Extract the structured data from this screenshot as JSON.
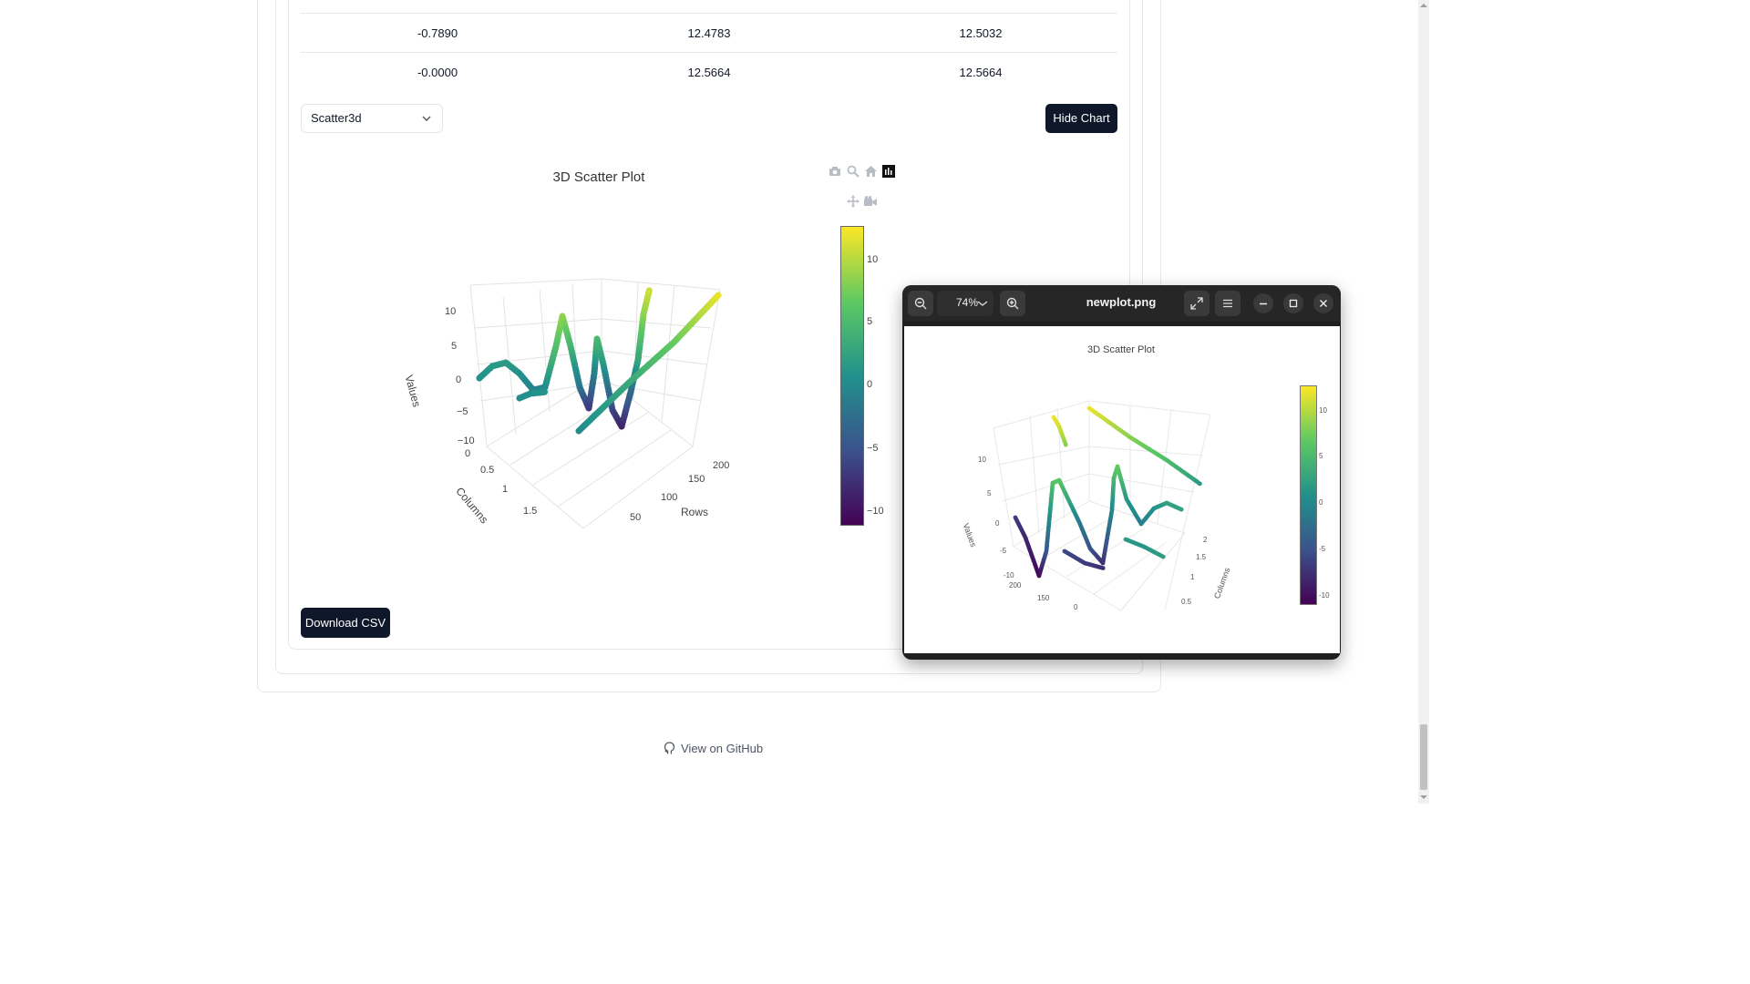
{
  "table": {
    "rows": [
      [
        "-0.7890",
        "12.4783",
        "12.5032"
      ],
      [
        "-0.0000",
        "12.5664",
        "12.5664"
      ]
    ]
  },
  "controls": {
    "chart_type_selected": "Scatter3d",
    "hide_chart_label": "Hide Chart",
    "download_csv_label": "Download CSV"
  },
  "chart_data": {
    "type": "scatter",
    "title": "3D Scatter Plot",
    "xlabel": "Rows",
    "ylabel": "Columns",
    "zlabel": "Values",
    "x_ticks": [
      "50",
      "100",
      "150",
      "200"
    ],
    "y_ticks": [
      "0",
      "0.5",
      "1",
      "1.5"
    ],
    "z_ticks": [
      "10",
      "5",
      "0",
      "−5",
      "−10"
    ],
    "colorbar_ticks": [
      "10",
      "5",
      "0",
      "−5",
      "−10"
    ],
    "colorscale": [
      "#440154",
      "#3b528b",
      "#21918c",
      "#5ec962",
      "#fde725"
    ],
    "zlim": [
      -12.6,
      12.6
    ]
  },
  "viewer": {
    "file_name": "newplot.png",
    "zoom": "74%",
    "image": {
      "title": "3D Scatter Plot",
      "z_ticks": [
        "10",
        "5",
        "0",
        "-5",
        "-10"
      ],
      "x_ticks": [
        "200",
        "150",
        "0"
      ],
      "y_ticks": [
        "2",
        "1.5",
        "1",
        "0.5"
      ],
      "zlabel": "Values",
      "ylabel": "Columns",
      "colorbar_ticks": [
        "10",
        "5",
        "0",
        "-5",
        "-10"
      ]
    }
  },
  "footer": {
    "github_label": "View on GitHub"
  },
  "icons": {
    "modebar": [
      "camera-icon",
      "zoom-icon",
      "home-icon",
      "bar-chart-icon",
      "pan-icon",
      "orbit-camera-icon",
      "turntable-icon",
      "anchor-icon"
    ],
    "viewer": [
      "zoom-out-icon",
      "zoom-in-icon",
      "fullscreen-icon",
      "menu-icon",
      "minimize-icon",
      "maximize-icon",
      "close-icon",
      "github-icon"
    ]
  }
}
